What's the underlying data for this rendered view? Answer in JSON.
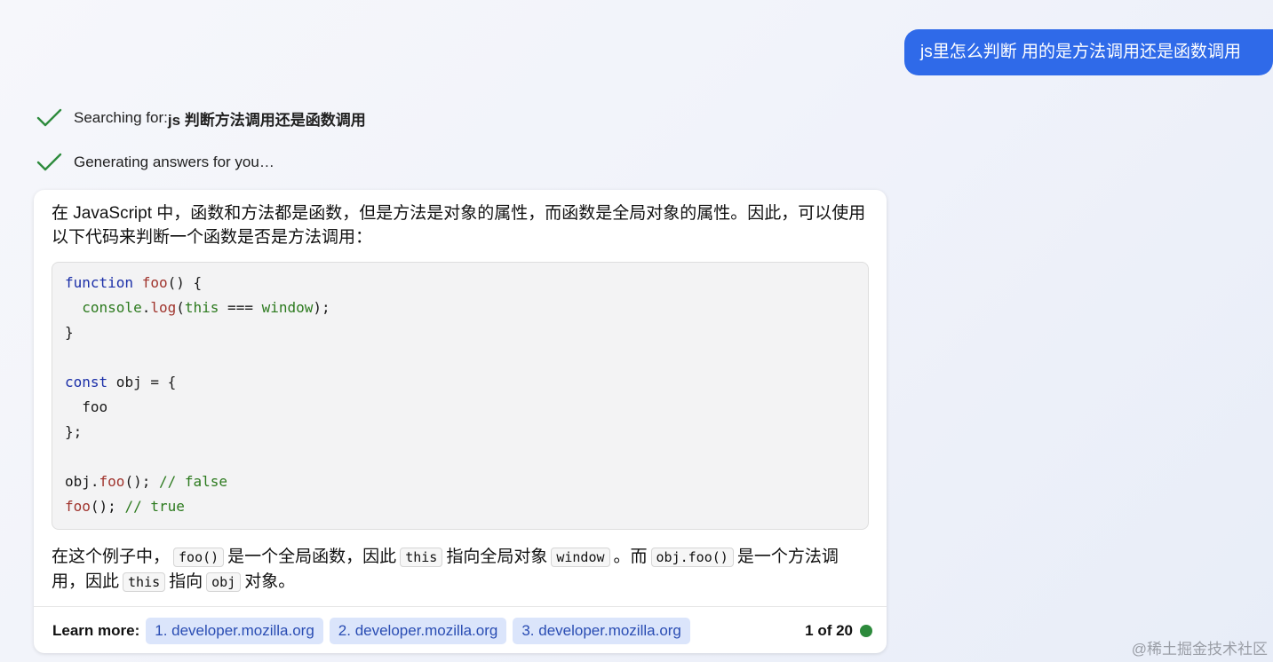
{
  "user_message": "js里怎么判断 用的是方法调用还是函数调用",
  "status": {
    "searching_label": "Searching for: ",
    "searching_query": "js 判断方法调用还是函数调用",
    "generating": "Generating answers for you…"
  },
  "answer": {
    "intro": "在 JavaScript 中，函数和方法都是函数，但是方法是对象的属性，而函数是全局对象的属性。因此，可以使用以下代码来判断一个函数是否是方法调用：",
    "code": {
      "l1_kw": "function",
      "l1_fn": "foo",
      "l1_rest": "() {",
      "l2_obj": "console",
      "l2_dot": ".",
      "l2_fn": "log",
      "l2_p1": "(",
      "l2_this": "this",
      "l2_op": " === ",
      "l2_win": "window",
      "l2_end": ");",
      "l3": "}",
      "l5_kw": "const",
      "l5_rest": " obj = {",
      "l6": "foo",
      "l7": "};",
      "l9_obj": "obj.",
      "l9_fn": "foo",
      "l9_rest": "(); ",
      "l9_cm": "// false",
      "l10_fn": "foo",
      "l10_rest": "(); ",
      "l10_cm": "// true"
    },
    "explain": {
      "t1": "在这个例子中，",
      "c1": "foo()",
      "t2": "是一个全局函数，因此",
      "c2": "this",
      "t3": "指向全局对象",
      "c3": "window",
      "t4": "。而",
      "c4": "obj.foo()",
      "t5": "是一个方法调用，因此",
      "c5": "this",
      "t6": "指向",
      "c6": "obj",
      "t7": "对象。"
    }
  },
  "footer": {
    "learn_more": "Learn more:",
    "sources": [
      "1. developer.mozilla.org",
      "2. developer.mozilla.org",
      "3. developer.mozilla.org"
    ],
    "counter": "1 of 20",
    "status_color": "#2d8a3c"
  },
  "watermark": "@稀土掘金技术社区"
}
